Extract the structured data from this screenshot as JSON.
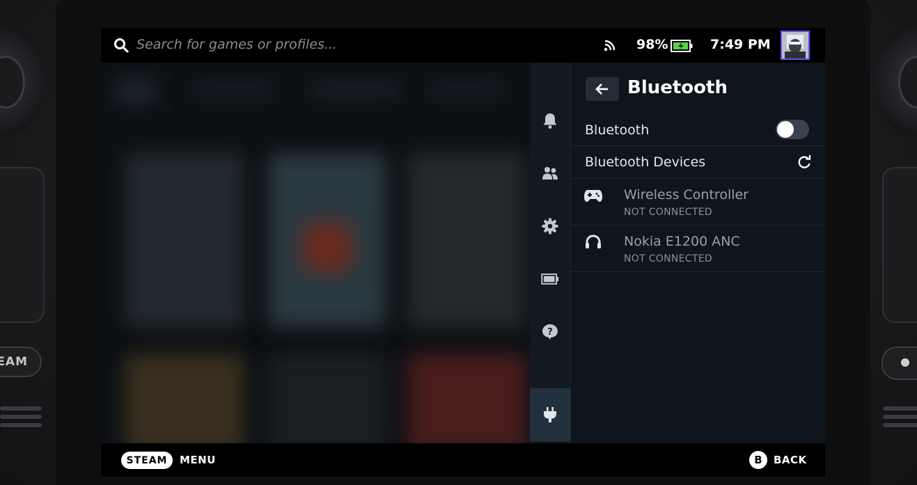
{
  "device": {
    "steam_button_label": "EAM"
  },
  "topbar": {
    "search_placeholder": "Search for games or profiles...",
    "battery_percent": "98%",
    "time": "7:49 PM"
  },
  "side_nav": {
    "items": [
      {
        "icon": "bell-icon"
      },
      {
        "icon": "friends-icon"
      },
      {
        "icon": "gear-icon"
      },
      {
        "icon": "battery-icon"
      },
      {
        "icon": "help-icon"
      },
      {
        "icon": "plug-icon",
        "active": true
      }
    ]
  },
  "panel": {
    "title": "Bluetooth",
    "bluetooth_toggle_label": "Bluetooth",
    "bluetooth_enabled": false,
    "devices_header": "Bluetooth Devices",
    "devices": [
      {
        "icon": "gamepad-icon",
        "name": "Wireless Controller",
        "status": "NOT CONNECTED"
      },
      {
        "icon": "headphones-icon",
        "name": "Nokia E1200 ANC",
        "status": "NOT CONNECTED"
      }
    ]
  },
  "bottombar": {
    "steam_label": "STEAM",
    "menu_label": "MENU",
    "b_label": "B",
    "back_label": "BACK"
  },
  "colors": {
    "accent_avatar_border": "#6a4df0",
    "battery_fill": "#5bd14a",
    "active_tab": "#23303e"
  }
}
